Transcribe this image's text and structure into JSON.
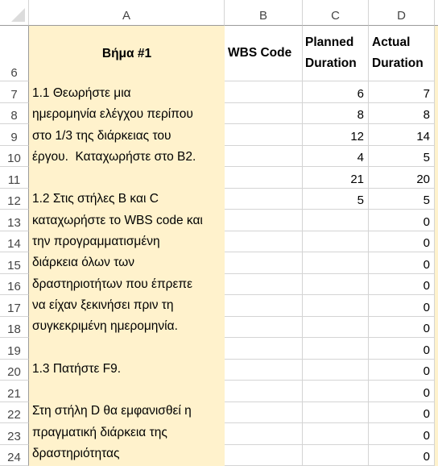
{
  "sheet": {
    "columns": [
      "A",
      "B",
      "C",
      "D"
    ],
    "rows": [
      "6",
      "7",
      "8",
      "9",
      "10",
      "11",
      "12",
      "13",
      "14",
      "15",
      "16",
      "17",
      "18",
      "19",
      "20",
      "21",
      "22",
      "23",
      "24"
    ],
    "header_row": {
      "A": "Βήμα #1",
      "B": "WBS Code",
      "C_line1": "Planned",
      "C_line2": "Duration",
      "D_line1": "Actual",
      "D_line2": "Duration"
    },
    "instructions_lines": [
      "1.1 Θεωρήστε μια",
      "ημερομηνία ελέγχου περίπου",
      "στο 1/3 της διάρκειας του",
      "έργου.  Καταχωρήστε στο B2.",
      "",
      "1.2 Στις στήλες B και C",
      "καταχωρήστε το WBS code και",
      "την προγραμματισμένη",
      "διάρκεια όλων των",
      "δραστηριοτήτων που έπρεπε",
      "να είχαν ξεκινήσει πριν τη",
      "συγκεκριμένη ημερομηνία.",
      "",
      "1.3 Πατήστε F9.",
      "",
      "Στη στήλη D θα εμφανισθεί η",
      "πραγματική διάρκεια της",
      "δραστηριότητας"
    ],
    "data_rows": [
      {
        "row": "7",
        "B": "",
        "C": "6",
        "D": "7"
      },
      {
        "row": "8",
        "B": "",
        "C": "8",
        "D": "8"
      },
      {
        "row": "9",
        "B": "",
        "C": "12",
        "D": "14"
      },
      {
        "row": "10",
        "B": "",
        "C": "4",
        "D": "5"
      },
      {
        "row": "11",
        "B": "",
        "C": "21",
        "D": "20"
      },
      {
        "row": "12",
        "B": "",
        "C": "5",
        "D": "5"
      },
      {
        "row": "13",
        "B": "",
        "C": "",
        "D": "0"
      },
      {
        "row": "14",
        "B": "",
        "C": "",
        "D": "0"
      },
      {
        "row": "15",
        "B": "",
        "C": "",
        "D": "0"
      },
      {
        "row": "16",
        "B": "",
        "C": "",
        "D": "0"
      },
      {
        "row": "17",
        "B": "",
        "C": "",
        "D": "0"
      },
      {
        "row": "18",
        "B": "",
        "C": "",
        "D": "0"
      },
      {
        "row": "19",
        "B": "",
        "C": "",
        "D": "0"
      },
      {
        "row": "20",
        "B": "",
        "C": "",
        "D": "0"
      },
      {
        "row": "21",
        "B": "",
        "C": "",
        "D": "0"
      },
      {
        "row": "22",
        "B": "",
        "C": "",
        "D": "0"
      },
      {
        "row": "23",
        "B": "",
        "C": "",
        "D": "0"
      },
      {
        "row": "24",
        "B": "",
        "C": "",
        "D": "0"
      }
    ],
    "colors": {
      "instruction_fill": "#fff2cc",
      "gridline": "#d4d4d4",
      "header_border": "#9b9b9b",
      "header_text": "#444444"
    }
  }
}
